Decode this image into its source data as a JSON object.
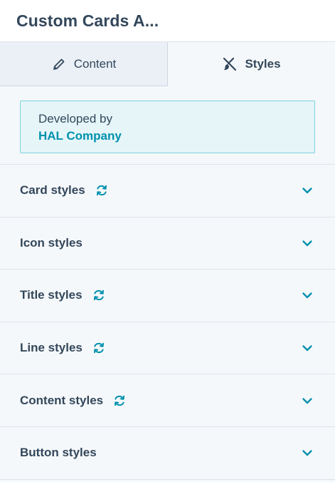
{
  "header": {
    "title": "Custom Cards A..."
  },
  "tabs": [
    {
      "label": "Content",
      "icon": "pencil-icon",
      "active": false
    },
    {
      "label": "Styles",
      "icon": "brush-tools-icon",
      "active": true
    }
  ],
  "developer": {
    "label": "Developed by",
    "company": "HAL Company"
  },
  "sections": [
    {
      "label": "Card styles",
      "sync": true
    },
    {
      "label": "Icon styles",
      "sync": false
    },
    {
      "label": "Title styles",
      "sync": true
    },
    {
      "label": "Line styles",
      "sync": true
    },
    {
      "label": "Content styles",
      "sync": true
    },
    {
      "label": "Button styles",
      "sync": false
    }
  ],
  "colors": {
    "accent": "#0091ae",
    "text": "#33475b",
    "dev_bg": "#e5f5f8",
    "dev_border": "#7fd1de"
  }
}
